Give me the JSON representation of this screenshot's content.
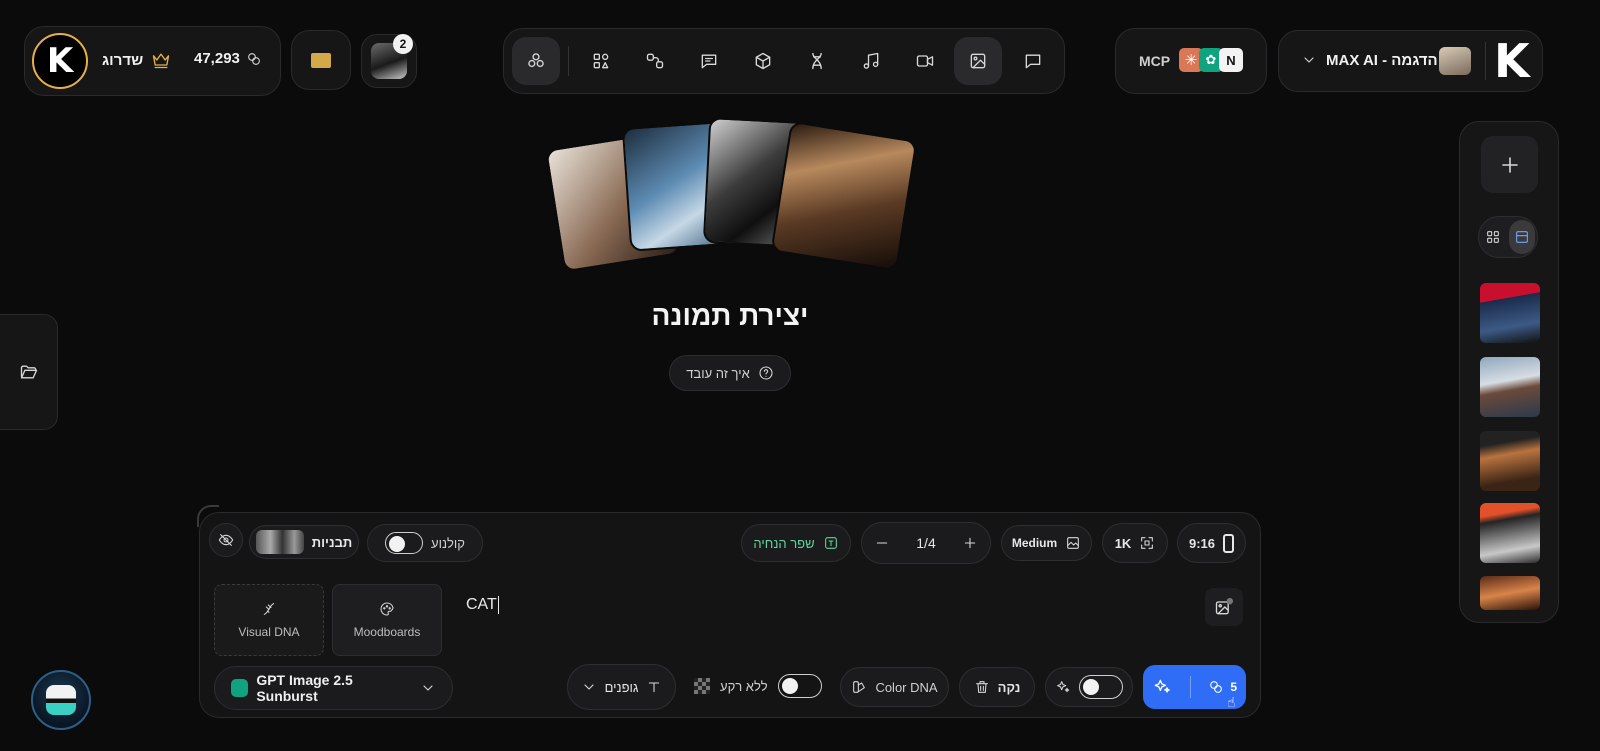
{
  "header": {
    "logo_letter": "K",
    "upgrade_label": "שדרוג",
    "credits": "47,293",
    "notification_count": "2",
    "mcp_label": "MCP",
    "workspace_label": "MAX AI - הדגמה"
  },
  "hero": {
    "title": "יצירת תמונה",
    "how_it_works": "איך זה עובד"
  },
  "composer": {
    "lens_label": "קולנוע",
    "templates_label": "תבניות",
    "improve_prompt_label": "שפר הנחיה",
    "count_value": "1/4",
    "quality_label": "Medium",
    "resolution_label": "1K",
    "aspect_label": "9:16",
    "prompt_value": "CAT",
    "visual_dna_label": "Visual DNA",
    "moodboards_label": "Moodboards",
    "model_label": "GPT Image 2.5 Sunburst",
    "fonts_label": "גופנים",
    "no_background_label": "ללא רקע",
    "color_dna_label": "Color DNA",
    "clear_label": "נקה",
    "generate_cost": "5"
  },
  "colors": {
    "accent_blue": "#2f6df6",
    "gold": "#e8b04a",
    "green_accent": "#5fd4a3"
  }
}
